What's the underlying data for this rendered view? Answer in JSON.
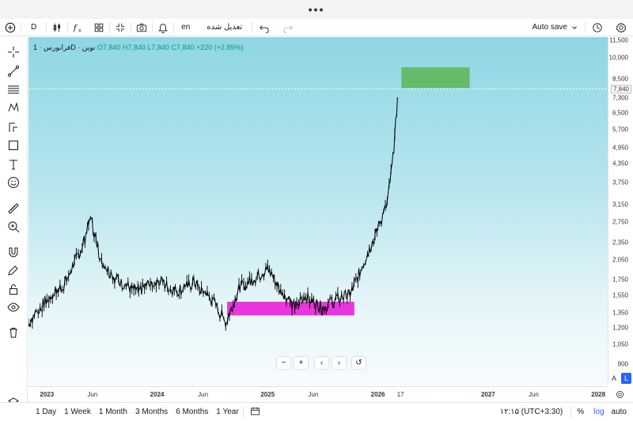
{
  "header": {
    "more_dots": "•••"
  },
  "toolbar": {
    "interval": "D",
    "language": "en",
    "edit_label": "تعدیل شده",
    "autosave": "Auto save"
  },
  "legend": {
    "symbol": "فرابورس · 1D · نوین",
    "open": "O7,840",
    "high": "H7,840",
    "low": "L7,840",
    "close": "C7,840",
    "change": "+220 (+2.89%)"
  },
  "price_axis": {
    "labels": [
      "11,500",
      "10,000",
      "8,500",
      "7,300",
      "6,500",
      "5,700",
      "4,950",
      "4,350",
      "3,750",
      "3,150",
      "2,750",
      "2,350",
      "2,050",
      "1,750",
      "1,550",
      "1,350",
      "1,200",
      "1,050",
      "900"
    ],
    "current": "7,840"
  },
  "time_axis": {
    "labels": [
      "2023",
      "Jun",
      "2024",
      "Jun",
      "2025",
      "Jun",
      "2026",
      "17",
      "2027",
      "Jun",
      "2028"
    ],
    "bold": [
      "2023",
      "2024",
      "2025",
      "2026",
      "2027",
      "2028"
    ]
  },
  "nav_controls": [
    "−",
    "+",
    "‹",
    "›",
    "↺"
  ],
  "scale_buttons": {
    "a": "A",
    "l": "L"
  },
  "bottom": {
    "ranges": [
      "1 Day",
      "1 Week",
      "1 Month",
      "3 Months",
      "6 Months",
      "1 Year"
    ],
    "clock": "۱۲:۱۵ (UTC+3:30)",
    "percent": "%",
    "log": "log",
    "auto": "auto"
  },
  "colors": {
    "buy_zone": "#e936e0",
    "target_zone": "#66bb6a",
    "candles": "#000000",
    "accent": "#2962ff"
  },
  "chart_data": {
    "type": "line",
    "title": "فرابورس · 1D · نوین",
    "ylabel": "",
    "yscale": "log",
    "ylim": [
      900,
      11500
    ],
    "x_range": [
      "2022-11",
      "2028-02"
    ],
    "series": [
      {
        "x": [
          "2022-11-01",
          "2023-01-01",
          "2023-03-01",
          "2023-05-01",
          "2023-05-25",
          "2023-07-01",
          "2023-09-01",
          "2023-11-01",
          "2024-01-01",
          "2024-03-01",
          "2024-05-01",
          "2024-07-01",
          "2024-08-15",
          "2024-10-01",
          "2024-12-01",
          "2025-01-01",
          "2025-02-01",
          "2025-04-01",
          "2025-05-01",
          "2025-07-01",
          "2025-08-15",
          "2025-10-01",
          "2025-11-15",
          "2026-01-01",
          "2026-02-01",
          "2026-02-20",
          "2026-03-10"
        ],
        "values": [
          1250,
          1500,
          1700,
          2300,
          2850,
          2000,
          1700,
          1600,
          1750,
          1600,
          1700,
          1500,
          1250,
          1650,
          1800,
          1900,
          1700,
          1400,
          1550,
          1400,
          1500,
          1550,
          2000,
          2600,
          3200,
          4500,
          7840
        ]
      }
    ],
    "annotations": [
      {
        "type": "rectangle",
        "label": "buy zone",
        "color": "#e936e0",
        "x_start": "2024-08-20",
        "x_end": "2025-10-15",
        "y_low": 1320,
        "y_high": 1470
      },
      {
        "type": "rectangle",
        "label": "target zone",
        "color": "#66bb6a",
        "x_start": "2026-03-20",
        "x_end": "2026-11-01",
        "y_low": 7900,
        "y_high": 9300
      }
    ]
  }
}
